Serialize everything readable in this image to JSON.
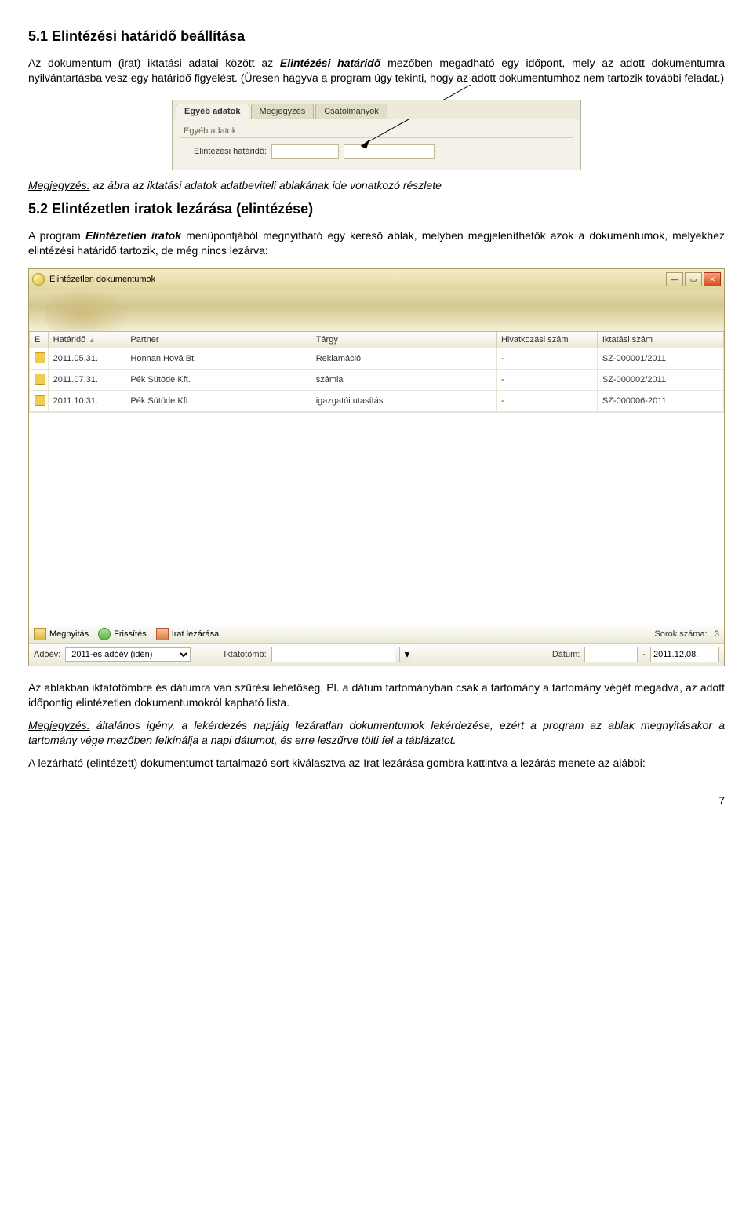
{
  "section51": {
    "heading": "5.1 Elintézési határidő beállítása",
    "para1_pre": "Az dokumentum (irat) iktatási adatai között az ",
    "para1_ital": "Elintézési határidő",
    "para1_post": " mezőben megadható egy időpont, mely az adott dokumentumra nyilvántartásba vesz egy határidő figyelést. (Üresen hagyva a program úgy tekinti, hogy az adott dokumentumhoz nem tartozik további feladat.)"
  },
  "shot1": {
    "tabs": [
      "Egyéb adatok",
      "Megjegyzés",
      "Csatolmányok"
    ],
    "panel_title": "Egyéb adatok",
    "field_label": "Elintézési határidő:",
    "field1": "",
    "field2": ""
  },
  "note1": {
    "label": "Megjegyzés:",
    "text": " az ábra az iktatási adatok adatbeviteli ablakának ide vonatkozó részlete"
  },
  "section52": {
    "heading": "5.2 Elintézetlen iratok lezárása (elintézése)",
    "para1_pre": "A program ",
    "para1_ital": "Elintézetlen iratok",
    "para1_post": " menüpontjából megnyitható egy kereső ablak, melyben megjeleníthetők azok a dokumentumok, melyekhez elintézési határidő tartozik, de még nincs lezárva:"
  },
  "shot2": {
    "title": "Elintézetlen dokumentumok",
    "columns": [
      "E",
      "Határidő",
      "Partner",
      "Tárgy",
      "Hivatkozási szám",
      "Iktatási szám"
    ],
    "rows": [
      {
        "date": "2011.05.31.",
        "partner": "Honnan Hová Bt.",
        "targy": "Reklamáció",
        "hiv": "-",
        "iktat": "SZ-000001/2011"
      },
      {
        "date": "2011.07.31.",
        "partner": "Pék Sütöde Kft.",
        "targy": "számla",
        "hiv": "-",
        "iktat": "SZ-000002/2011"
      },
      {
        "date": "2011.10.31.",
        "partner": "Pék Sütöde Kft.",
        "targy": "igazgatói utasítás",
        "hiv": "-",
        "iktat": "SZ-000006-2011"
      }
    ],
    "toolbar": {
      "open": "Megnyitás",
      "refresh": "Frissítés",
      "close": "Irat lezárása",
      "count_label": "Sorok száma:",
      "count_value": "3"
    },
    "filter": {
      "ado_label": "Adóév:",
      "ado_value": "2011-es adóév (idén)",
      "iktat_label": "Iktatótömb:",
      "iktat_value": "",
      "date_label": "Dátum:",
      "date_from": "",
      "date_sep": "-",
      "date_to": "2011.12.08."
    }
  },
  "para_after": "Az ablakban iktatótömbre és dátumra van szűrési lehetőség. Pl. a dátum tartományban csak a tartomány a tartomány végét megadva, az adott időpontig elintézetlen dokumentumokról kapható lista.",
  "note2": {
    "label": "Megjegyzés:",
    "text": " általános igény, a lekérdezés napjáig lezáratlan dokumentumok lekérdezése, ezért a program az ablak megnyitásakor a tartomány vége mezőben felkínálja a napi dátumot, és erre leszűrve tölti fel a táblázatot."
  },
  "para_last": "A lezárható (elintézett) dokumentumot tartalmazó sort kiválasztva az Irat lezárása gombra kattintva a lezárás menete az alábbi:",
  "pagenum": "7"
}
